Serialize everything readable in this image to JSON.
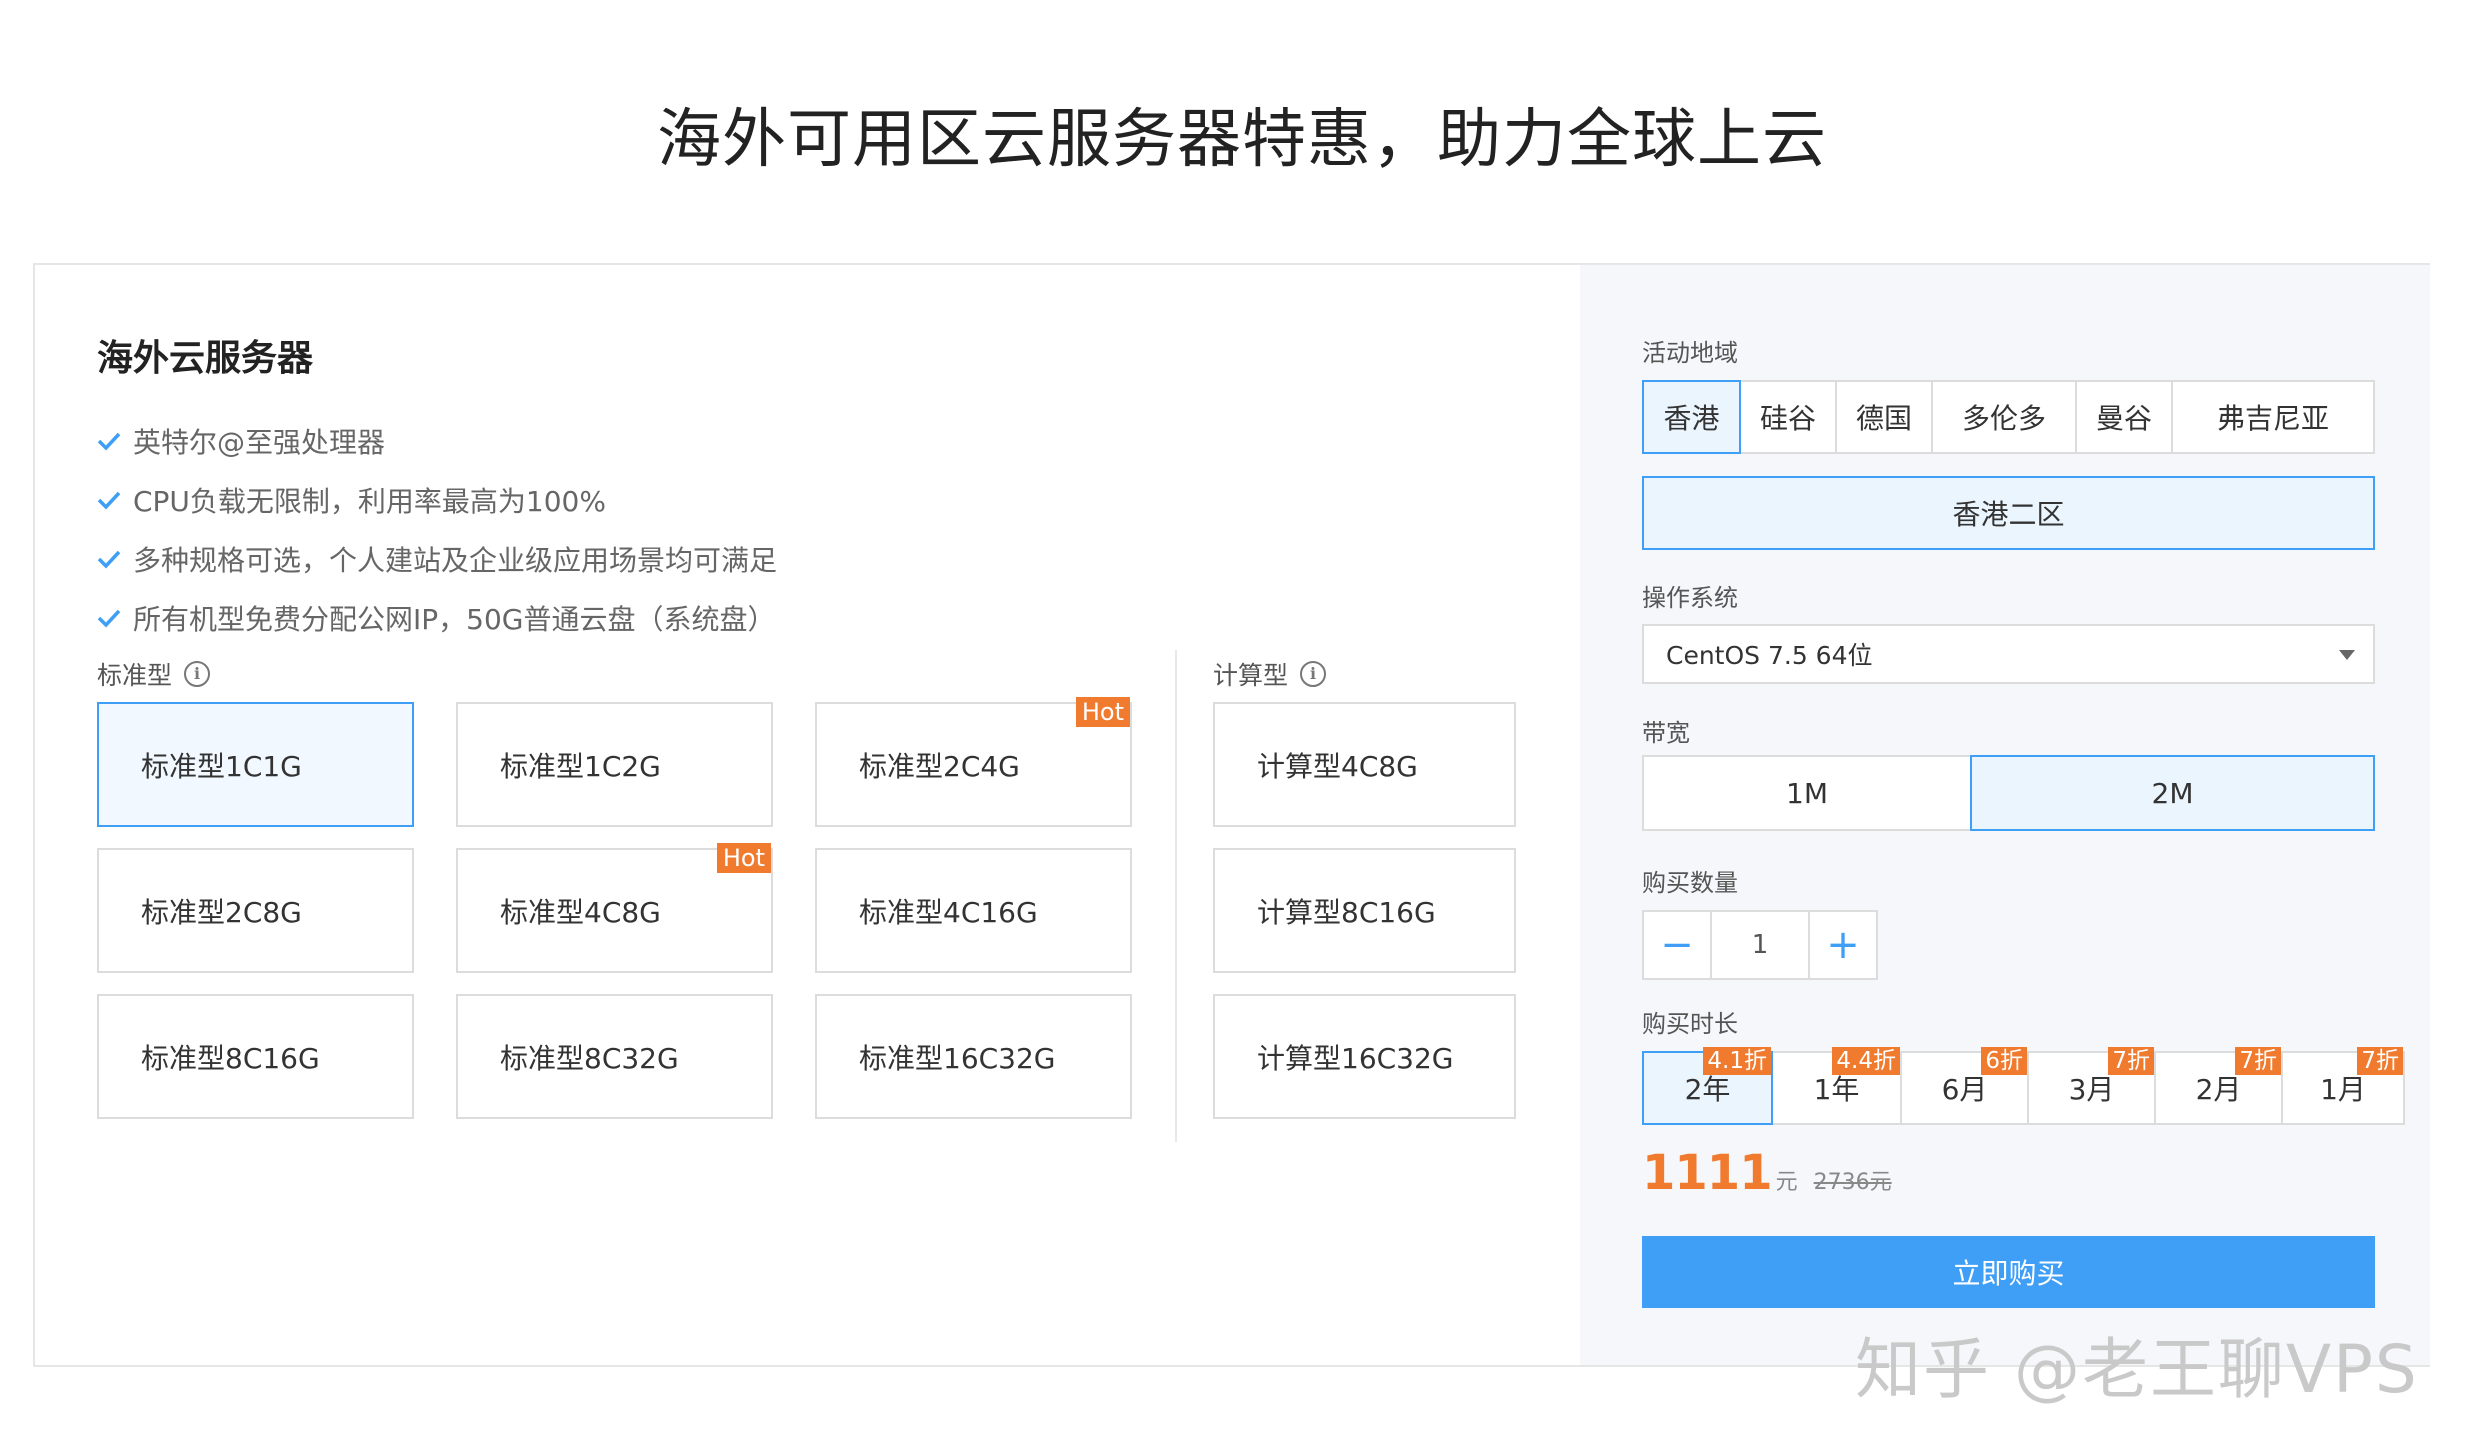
{
  "page_title": "海外可用区云服务器特惠，助力全球上云",
  "card": {
    "title": "海外云服务器",
    "features": [
      "英特尔@至强处理器",
      "CPU负载无限制，利用率最高为100%",
      "多种规格可选，个人建站及企业级应用场景均可满足",
      "所有机型免费分配公网IP，50G普通云盘（系统盘）"
    ],
    "standard": {
      "label": "标准型",
      "items": [
        {
          "name": "标准型1C1G",
          "selected": true,
          "badge": ""
        },
        {
          "name": "标准型1C2G",
          "badge": ""
        },
        {
          "name": "标准型2C4G",
          "badge": "Hot"
        },
        {
          "name": "标准型2C8G",
          "badge": ""
        },
        {
          "name": "标准型4C8G",
          "badge": "Hot"
        },
        {
          "name": "标准型4C16G",
          "badge": ""
        },
        {
          "name": "标准型8C16G",
          "badge": ""
        },
        {
          "name": "标准型8C32G",
          "badge": ""
        },
        {
          "name": "标准型16C32G",
          "badge": ""
        }
      ]
    },
    "compute": {
      "label": "计算型",
      "items": [
        {
          "name": "计算型4C8G"
        },
        {
          "name": "计算型8C16G"
        },
        {
          "name": "计算型16C32G"
        }
      ]
    }
  },
  "order": {
    "region_label": "活动地域",
    "regions": [
      "香港",
      "硅谷",
      "德国",
      "多伦多",
      "曼谷",
      "弗吉尼亚"
    ],
    "selected_region": "香港",
    "zone": "香港二区",
    "os_label": "操作系统",
    "os_value": "CentOS 7.5 64位",
    "bandwidth_label": "带宽",
    "bandwidth_options": [
      "1M",
      "2M"
    ],
    "bandwidth_selected": "2M",
    "quantity_label": "购买数量",
    "quantity": "1",
    "minus": "−",
    "plus": "+",
    "duration_label": "购买时长",
    "durations": [
      {
        "label": "2年",
        "discount": "4.1折",
        "selected": true
      },
      {
        "label": "1年",
        "discount": "4.4折"
      },
      {
        "label": "6月",
        "discount": "6折"
      },
      {
        "label": "3月",
        "discount": "7折"
      },
      {
        "label": "2月",
        "discount": "7折"
      },
      {
        "label": "1月",
        "discount": "7折"
      }
    ],
    "price": "1111",
    "price_unit": "元",
    "original_price": "2736元",
    "buy_label": "立即购买"
  },
  "watermark": "知乎 @老王聊VPS",
  "colors": {
    "accent": "#3f9ef6",
    "badge": "#f07a2d",
    "selected_bg": "#eaf5fd"
  },
  "icons": [
    "check-icon",
    "info-icon",
    "chevron-down-icon",
    "minus-icon",
    "plus-icon"
  ]
}
